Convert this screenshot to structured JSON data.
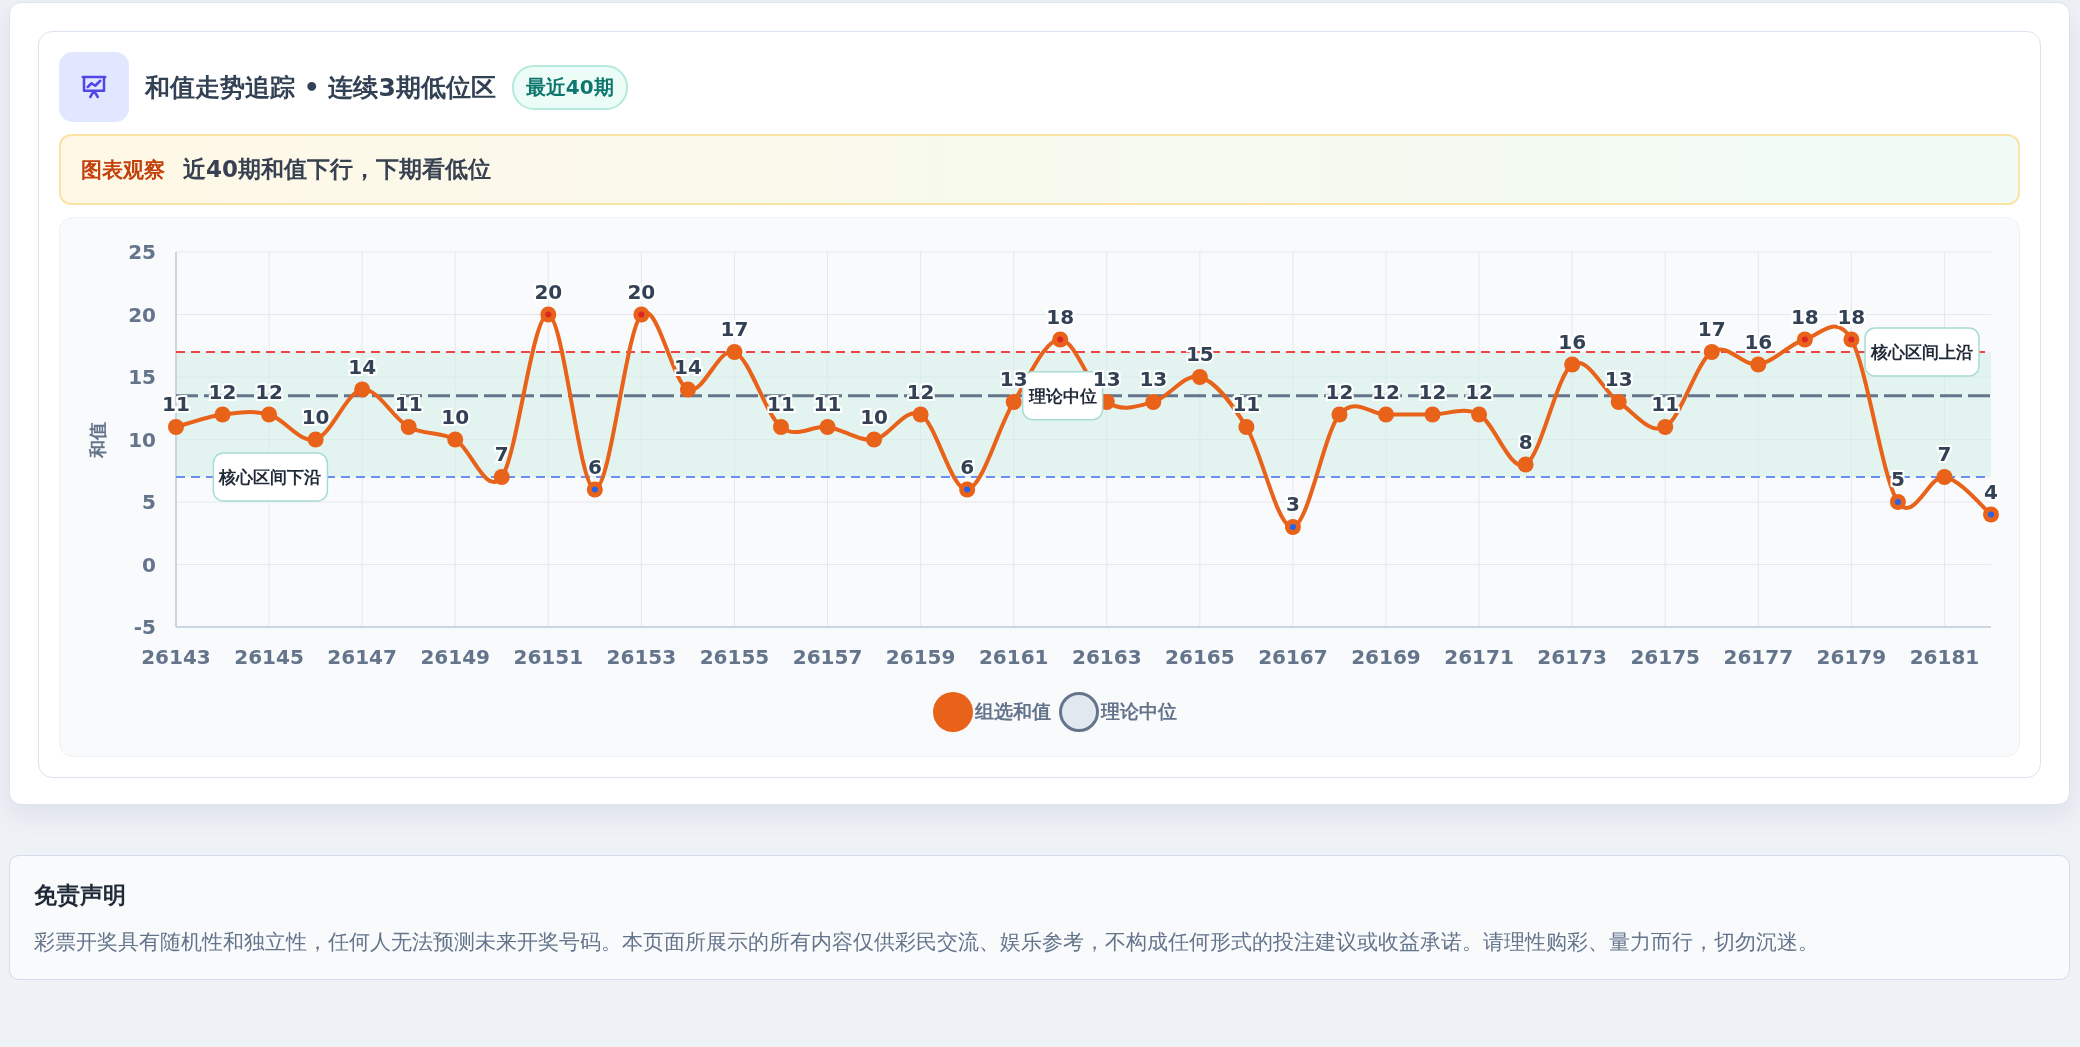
{
  "header": {
    "title": "和值走势追踪 • 连续3期低位区",
    "badge": "最近40期"
  },
  "observation": {
    "label": "图表观察",
    "text": "近40期和值下行，下期看低位"
  },
  "chart": {
    "chart_data": {
      "type": "line",
      "ylabel": "和值",
      "x": [
        26143,
        26144,
        26145,
        26146,
        26147,
        26148,
        26149,
        26150,
        26151,
        26152,
        26153,
        26154,
        26155,
        26156,
        26157,
        26158,
        26159,
        26160,
        26161,
        26162,
        26163,
        26164,
        26165,
        26166,
        26167,
        26168,
        26169,
        26170,
        26171,
        26172,
        26173,
        26174,
        26175,
        26176,
        26177,
        26178,
        26179,
        26180,
        26181,
        26182
      ],
      "series": [
        {
          "name": "组选和值",
          "color": "#e8621a",
          "marker": "circle",
          "values": [
            11,
            12,
            12,
            10,
            14,
            11,
            10,
            7,
            20,
            6,
            20,
            14,
            17,
            11,
            11,
            10,
            12,
            6,
            13,
            18,
            13,
            13,
            15,
            11,
            3,
            12,
            12,
            12,
            12,
            8,
            16,
            13,
            11,
            17,
            16,
            18,
            18,
            5,
            7,
            4
          ],
          "value_labels": [
            "11",
            "12",
            "12",
            "10",
            "14",
            "11",
            "10",
            "7",
            "20",
            "6",
            "20",
            "14",
            "17",
            "11",
            "11",
            "10",
            "12",
            "6",
            "13",
            "18",
            "13",
            "13",
            "15",
            "11",
            "3",
            "12",
            "12",
            "12",
            "12",
            "8",
            "16",
            "13",
            "11",
            "17",
            "16",
            "18",
            "18",
            "5",
            "7",
            "4"
          ]
        },
        {
          "name": "理论中位",
          "color": "#64748b",
          "line_style": "dashed",
          "values": [
            13.5,
            13.5,
            13.5,
            13.5,
            13.5,
            13.5,
            13.5,
            13.5,
            13.5,
            13.5,
            13.5,
            13.5,
            13.5,
            13.5,
            13.5,
            13.5,
            13.5,
            13.5,
            13.5,
            null,
            null,
            13.5,
            13.5,
            13.5,
            13.5,
            13.5,
            13.5,
            13.5,
            13.5,
            13.5,
            13.5,
            13.5,
            13.5,
            13.5,
            13.5,
            13.5,
            13.5,
            13.5,
            13.5,
            13.5
          ]
        },
        {
          "color": "#ef4444",
          "line_style": "dashed",
          "values": [
            17,
            17,
            17,
            17,
            17,
            17,
            17,
            17,
            17,
            17,
            17,
            17,
            17,
            17,
            17,
            17,
            17,
            17,
            17,
            17,
            17,
            17,
            17,
            17,
            17,
            17,
            17,
            17,
            17,
            17,
            17,
            17,
            17,
            17,
            17,
            17,
            17,
            null,
            null,
            17
          ]
        },
        {
          "color": "#6b8ef0",
          "line_style": "dashed",
          "values": [
            7,
            null,
            null,
            null,
            7,
            7,
            7,
            7,
            7,
            7,
            7,
            7,
            7,
            7,
            7,
            7,
            7,
            7,
            7,
            7,
            7,
            7,
            7,
            7,
            7,
            7,
            7,
            7,
            7,
            7,
            7,
            7,
            7,
            7,
            7,
            7,
            7,
            7,
            7,
            7
          ]
        }
      ],
      "xlim": [
        26143,
        26182
      ],
      "ylim": [
        -5,
        25
      ],
      "yticks": [
        -5,
        0,
        5,
        10,
        15,
        20,
        25
      ],
      "xticks": [
        26143,
        26145,
        26147,
        26149,
        26151,
        26153,
        26155,
        26157,
        26159,
        26161,
        26163,
        26165,
        26167,
        26169,
        26171,
        26173,
        26175,
        26177,
        26179,
        26181
      ],
      "grid": true,
      "annotations": [
        "核心区间上沿",
        "核心区间下沿",
        "理论中位"
      ]
    }
  },
  "disclaimer": {
    "title": "免责声明",
    "text": "彩票开奖具有随机性和独立性，任何人无法预测未来开奖号码。本页面所展示的所有内容仅供彩民交流、娱乐参考，不构成任何形式的投注建议或收益承诺。请理性购彩、量力而行，切勿沉迷。"
  }
}
